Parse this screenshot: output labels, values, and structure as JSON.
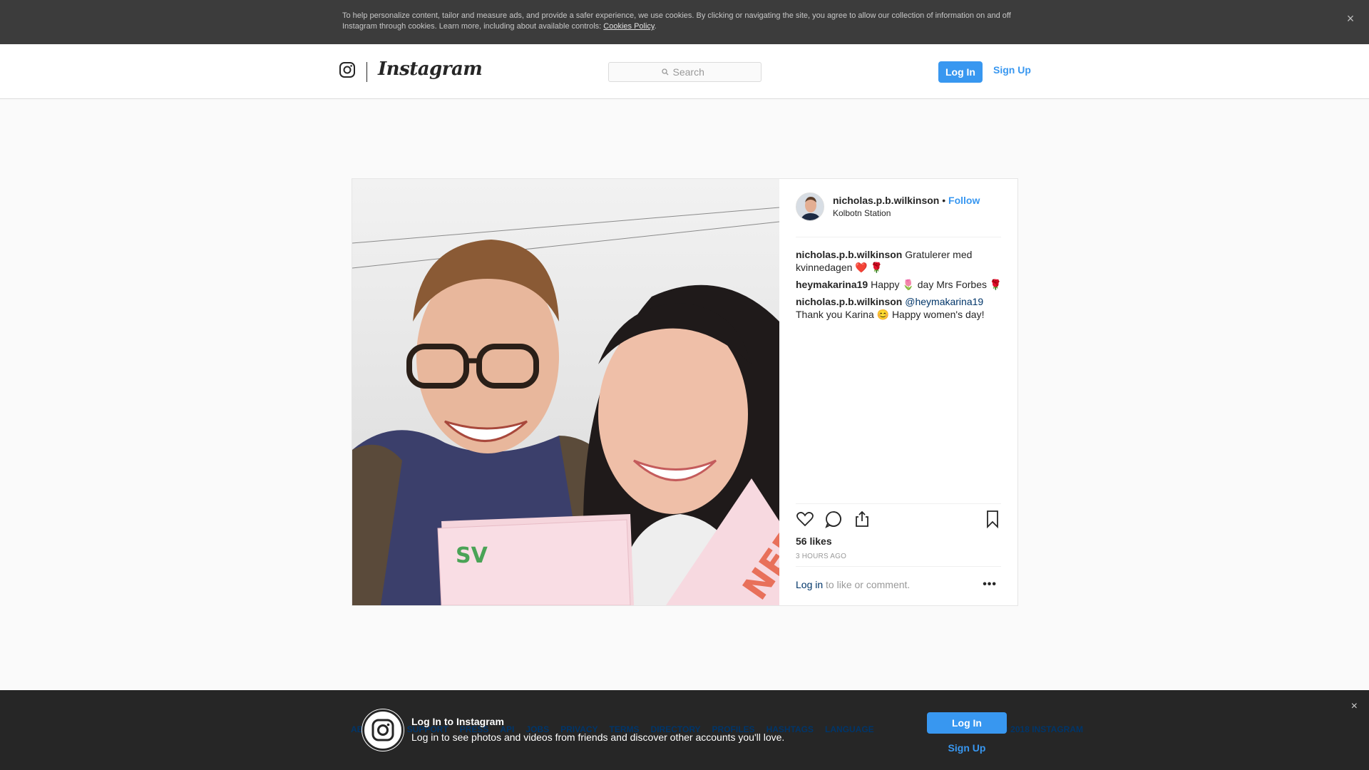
{
  "cookie_banner": {
    "text": "To help personalize content, tailor and measure ads, and provide a safer experience, we use cookies. By clicking or navigating the site, you agree to allow our collection of information on and off Instagram through cookies. Learn more, including about available controls: ",
    "link": "Cookies Policy",
    "trailing": ".",
    "close_icon": "×"
  },
  "header": {
    "brand": "Instagram",
    "search_placeholder": "Search",
    "login": "Log In",
    "signup": "Sign Up"
  },
  "post": {
    "author": "nicholas.p.b.wilkinson",
    "separator": " • ",
    "follow": "Follow",
    "location": "Kolbotn Station",
    "comments": [
      {
        "user": "nicholas.p.b.wilkinson",
        "text": " Gratulerer med kvinnedagen ❤️ 🌹"
      },
      {
        "user": "heymakarina19",
        "text": " Happy 🌷 day Mrs Forbes 🌹"
      },
      {
        "user": "nicholas.p.b.wilkinson",
        "mention": "@heymakarina19",
        "text": "Thank you Karina 😊 Happy women's day!"
      }
    ],
    "likes": "56 likes",
    "time": "3 HOURS AGO",
    "login_link": "Log in",
    "login_rest": " to like or comment.",
    "more": "•••",
    "photo_sign_text": "SV"
  },
  "footer": {
    "links": [
      "ABOUT US",
      "SUPPORT",
      "PRESS",
      "API",
      "JOBS",
      "PRIVACY",
      "TERMS",
      "DIRECTORY",
      "PROFILES",
      "HASHTAGS",
      "LANGUAGE"
    ],
    "right": "© 2018 INSTAGRAM"
  },
  "login_modal": {
    "title": "Log In to Instagram",
    "subtitle": "Log in to see photos and videos from friends and discover other accounts you'll love.",
    "login": "Log In",
    "signup": "Sign Up",
    "close_icon": "×"
  },
  "colors": {
    "accent": "#3897f0",
    "link_dark": "#003569",
    "banner_bg": "#3c3c3c",
    "bottom_bg": "#262626"
  }
}
